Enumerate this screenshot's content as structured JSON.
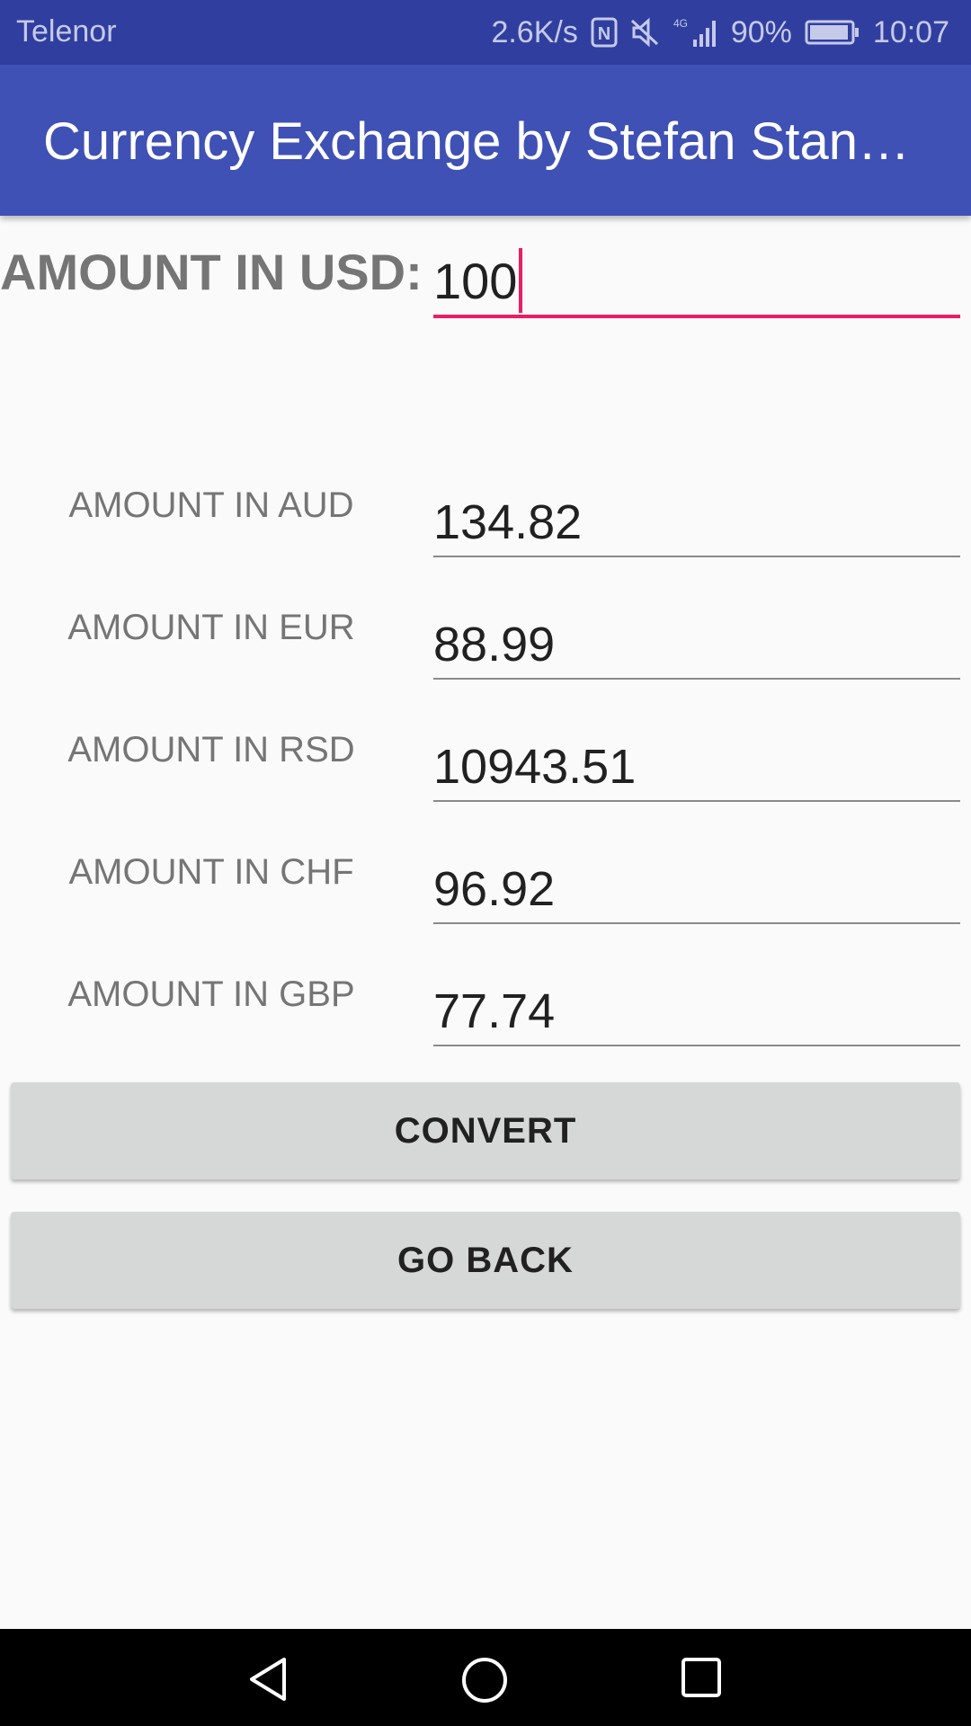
{
  "status_bar": {
    "carrier": "Telenor",
    "speed": "2.6K/s",
    "network": "4G",
    "battery": "90%",
    "time": "10:07",
    "icons": [
      "nfc-icon",
      "mute-icon",
      "signal-icon",
      "battery-icon"
    ]
  },
  "app_bar": {
    "title": "Currency Exchange by Stefan Stan…"
  },
  "usd": {
    "label": "AMOUNT IN USD:",
    "value": "100"
  },
  "conversions": [
    {
      "label": "AMOUNT IN AUD",
      "value": "134.82"
    },
    {
      "label": "AMOUNT IN EUR",
      "value": "88.99"
    },
    {
      "label": "AMOUNT IN RSD",
      "value": "10943.51"
    },
    {
      "label": "AMOUNT IN CHF",
      "value": "96.92"
    },
    {
      "label": "AMOUNT IN GBP",
      "value": "77.74"
    }
  ],
  "buttons": {
    "convert": "CONVERT",
    "go_back": "GO BACK"
  },
  "nav_bar": {
    "icons": [
      "back-icon",
      "home-icon",
      "recents-icon"
    ]
  },
  "colors": {
    "primary": "#3f51b5",
    "primary_dark": "#303f9f",
    "accent": "#e91e63"
  }
}
